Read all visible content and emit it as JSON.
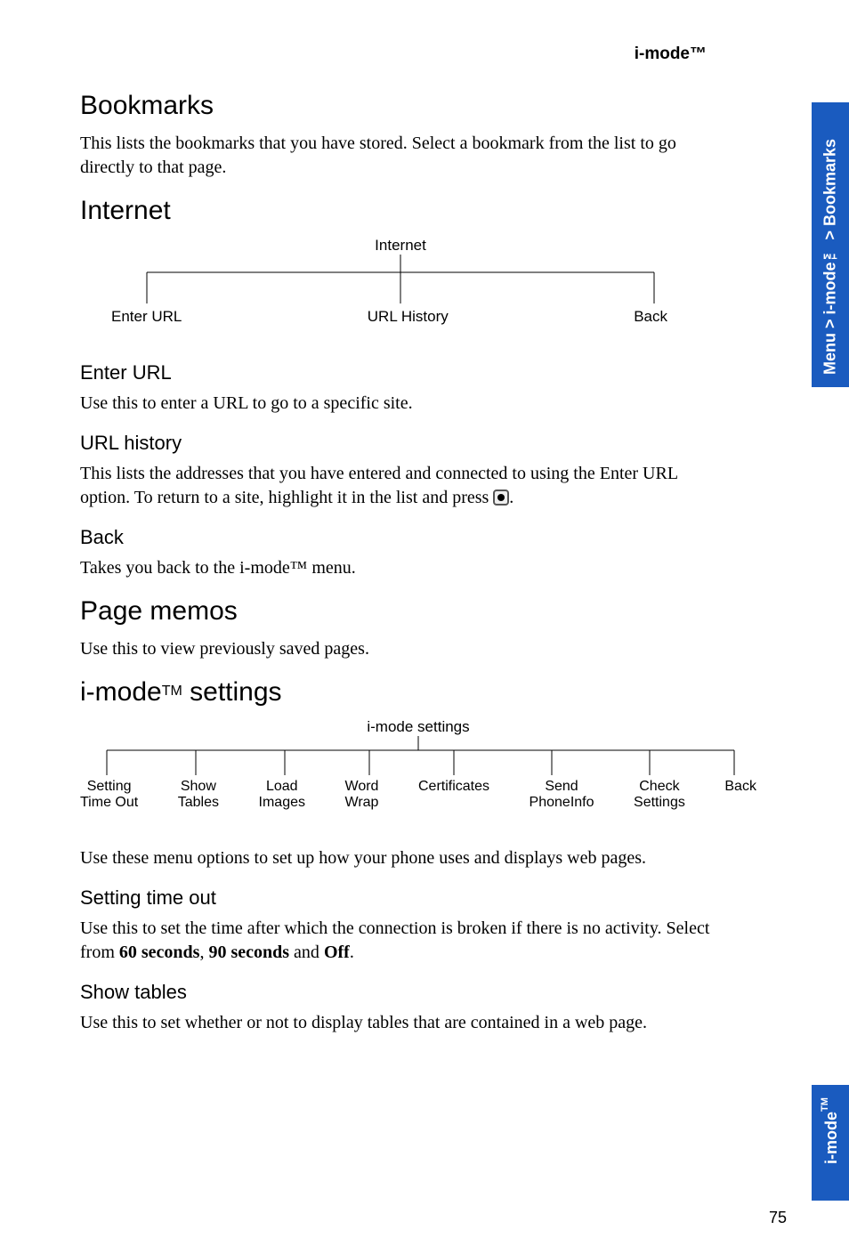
{
  "header": {
    "section": "i-mode™"
  },
  "sidebar": {
    "breadcrumb": "Menu > i-mode™ > Bookmarks",
    "chapter": "i-mode",
    "chapter_tm": "TM"
  },
  "page_number": "75",
  "sections": {
    "bookmarks": {
      "title": "Bookmarks",
      "body": "This lists the bookmarks that you have stored. Select a bookmark from the list to go directly to that page."
    },
    "internet": {
      "title": "Internet",
      "tree_root": "Internet",
      "leaves": [
        "Enter URL",
        "URL History",
        "Back"
      ]
    },
    "enter_url": {
      "title": "Enter URL",
      "body": "Use this to enter a URL to go to a specific site."
    },
    "url_history": {
      "title": "URL history",
      "body_pre": "This lists the addresses that you have entered and connected to using the Enter URL option. To return to a site, highlight it in the list and press ",
      "body_post": "."
    },
    "back": {
      "title": "Back",
      "body": "Takes you back to the i-mode™ menu."
    },
    "page_memos": {
      "title": "Page memos",
      "body": "Use this to view previously saved pages."
    },
    "imode_settings": {
      "title_pre": "i-mode",
      "title_tm": "TM",
      "title_post": " settings",
      "tree_root": "i-mode settings",
      "leaves": [
        "Setting\nTime Out",
        "Show\nTables",
        "Load\nImages",
        "Word\nWrap",
        "Certificates",
        "Send\nPhoneInfo",
        "Check\nSettings",
        "Back"
      ],
      "body": "Use these menu options to set up how your phone uses and displays web pages."
    },
    "setting_timeout": {
      "title": "Setting time out",
      "body_pre": "Use this to set the time after which the connection is broken if there is no activity. Select from ",
      "opt1": "60 seconds",
      "sep1": ", ",
      "opt2": "90 seconds",
      "sep2": " and ",
      "opt3": "Off",
      "body_post": "."
    },
    "show_tables": {
      "title": "Show tables",
      "body": "Use this to set whether or not to display tables that are contained in a web page."
    }
  }
}
